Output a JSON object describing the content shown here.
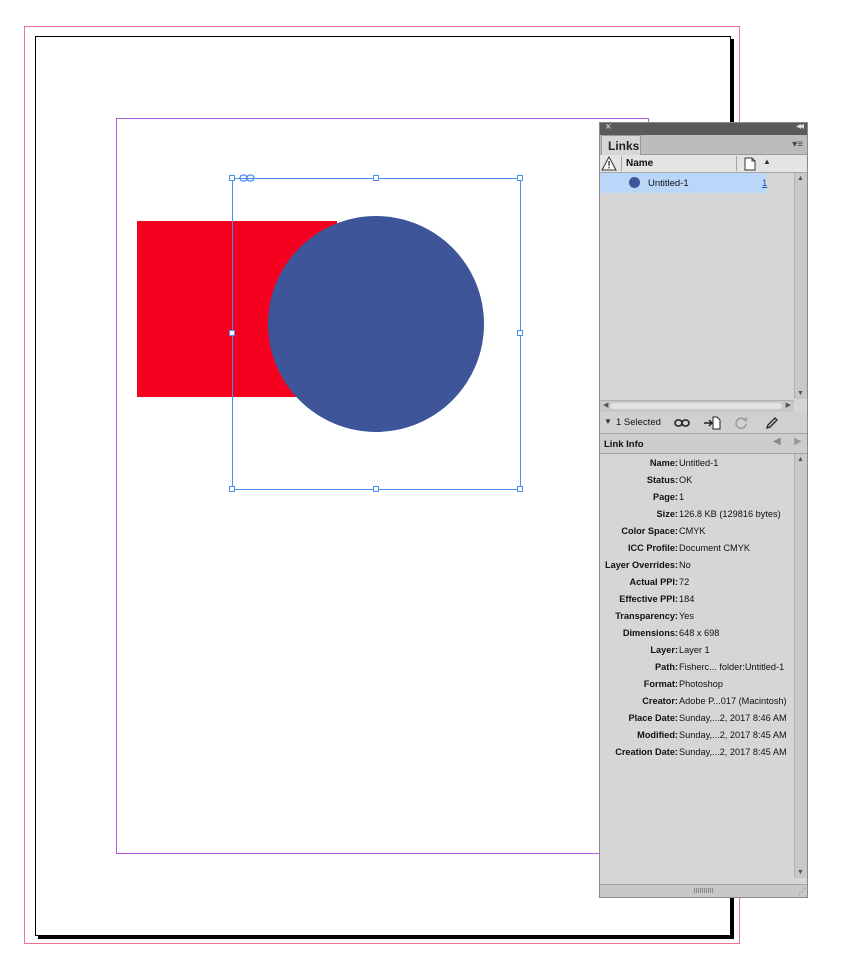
{
  "panel": {
    "close_glyph": "×",
    "collapse_glyph": "◂◂",
    "tab_label": "Links",
    "menu_glyph": "▾≡",
    "column_name": "Name",
    "sort_glyph": "▲",
    "selection_color": "#bad6f8"
  },
  "links": [
    {
      "name": "Untitled-1",
      "page": "1",
      "status_icon": "embedded-circle-icon"
    }
  ],
  "toolbar": {
    "disclosure_glyph": "▼",
    "selected_text": "1 Selected",
    "icons": [
      "relink-icon",
      "goto-link-icon",
      "update-link-icon",
      "edit-original-icon"
    ]
  },
  "link_info": {
    "title": "Link Info",
    "prev_glyph": "◀",
    "next_glyph": "▶",
    "rows": [
      {
        "key": "Name:",
        "value": "Untitled-1"
      },
      {
        "key": "Status:",
        "value": "OK"
      },
      {
        "key": "Page:",
        "value": "1"
      },
      {
        "key": "Size:",
        "value": "126.8 KB (129816 bytes)"
      },
      {
        "key": "Color Space:",
        "value": "CMYK"
      },
      {
        "key": "ICC Profile:",
        "value": "Document CMYK"
      },
      {
        "key": "Layer Overrides:",
        "value": "No"
      },
      {
        "key": "Actual PPI:",
        "value": "72"
      },
      {
        "key": "Effective PPI:",
        "value": "184"
      },
      {
        "key": "Transparency:",
        "value": "Yes"
      },
      {
        "key": "Dimensions:",
        "value": "648 x 698"
      },
      {
        "key": "Layer:",
        "value": "Layer 1"
      },
      {
        "key": "Path:",
        "value": "Fisherc... folder:Untitled-1"
      },
      {
        "key": "Format:",
        "value": "Photoshop"
      },
      {
        "key": "Creator:",
        "value": "Adobe P...017 (Macintosh)"
      },
      {
        "key": "Place Date:",
        "value": "Sunday,...2, 2017 8:46 AM"
      },
      {
        "key": "Modified:",
        "value": "Sunday,...2, 2017 8:45 AM"
      },
      {
        "key": "Creation Date:",
        "value": "Sunday,...2, 2017 8:45 AM"
      }
    ]
  },
  "canvas": {
    "rect_color": "#f6001f",
    "circle_color": "#3e5699",
    "selection_color": "#4a8ef0",
    "margin_guide_color": "#b25ce0",
    "bleed_guide_color": "#f0728a"
  }
}
